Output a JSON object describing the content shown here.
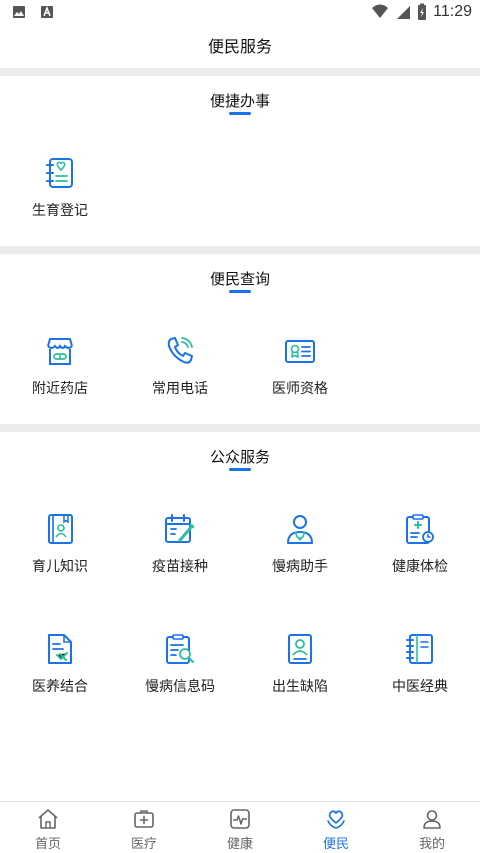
{
  "status_bar": {
    "time": "11:29"
  },
  "header": {
    "title": "便民服务"
  },
  "sections": [
    {
      "title": "便捷办事",
      "items": [
        {
          "label": "生育登记",
          "icon": "registration-book-icon"
        }
      ]
    },
    {
      "title": "便民查询",
      "items": [
        {
          "label": "附近药店",
          "icon": "pharmacy-store-icon"
        },
        {
          "label": "常用电话",
          "icon": "phone-icon"
        },
        {
          "label": "医师资格",
          "icon": "certificate-card-icon"
        }
      ]
    },
    {
      "title": "公众服务",
      "items": [
        {
          "label": "育儿知识",
          "icon": "parenting-book-icon"
        },
        {
          "label": "疫苗接种",
          "icon": "vaccine-calendar-icon"
        },
        {
          "label": "慢病助手",
          "icon": "doctor-assistant-icon"
        },
        {
          "label": "健康体检",
          "icon": "health-checkup-clipboard-icon"
        },
        {
          "label": "医养结合",
          "icon": "medical-care-document-icon"
        },
        {
          "label": "慢病信息码",
          "icon": "info-code-search-icon"
        },
        {
          "label": "出生缺陷",
          "icon": "birth-defect-card-icon"
        },
        {
          "label": "中医经典",
          "icon": "tcm-classic-book-icon"
        }
      ]
    }
  ],
  "tabbar": {
    "active": "便民",
    "tabs": [
      {
        "label": "首页",
        "icon": "home-icon"
      },
      {
        "label": "医疗",
        "icon": "medical-kit-icon"
      },
      {
        "label": "健康",
        "icon": "heartbeat-icon"
      },
      {
        "label": "便民",
        "icon": "heart-hands-icon"
      },
      {
        "label": "我的",
        "icon": "user-icon"
      }
    ]
  },
  "colors": {
    "accent": "#1a73e8",
    "icon_green": "#2bbfa0",
    "separator": "#ececec"
  }
}
